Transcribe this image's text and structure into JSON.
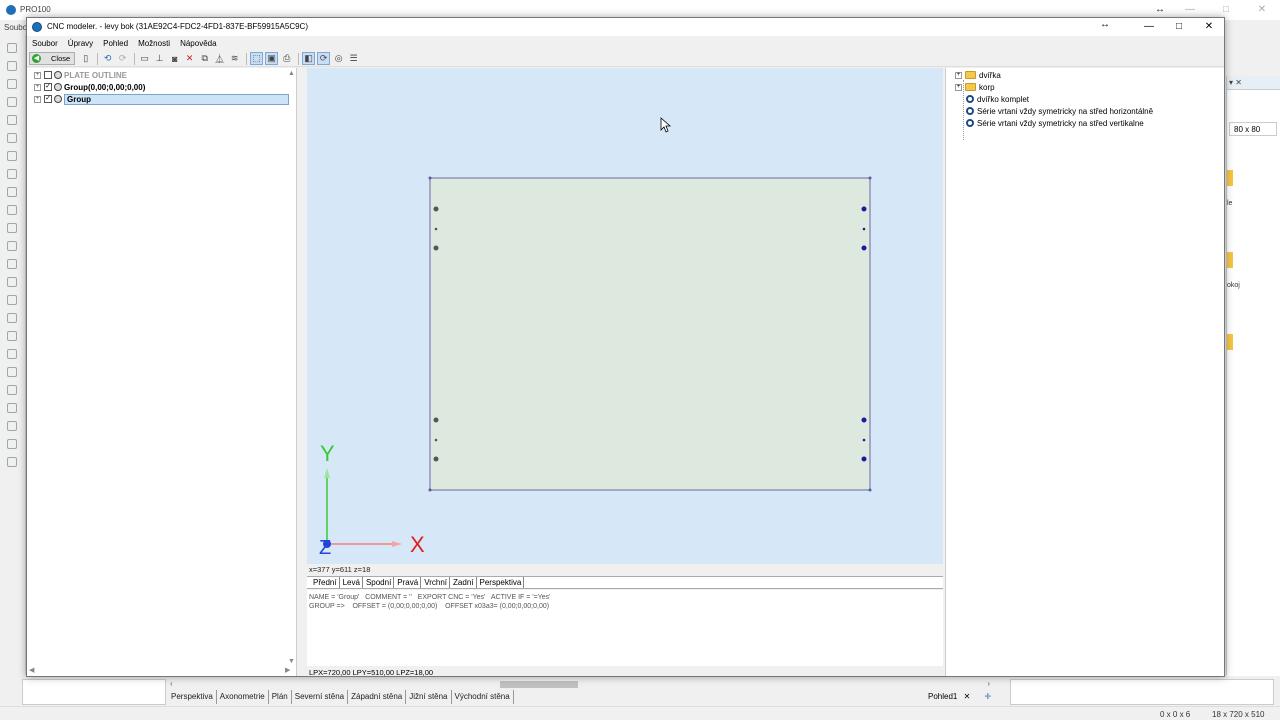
{
  "background_app": {
    "title": "PRO100",
    "menu_label": "Soubo",
    "bottom_tabs": [
      "Perspektiva",
      "Axonometrie",
      "Plán",
      "Severní stěna",
      "Západní stěna",
      "Jižní stěna",
      "Východní stěna"
    ],
    "view_name": "Pohled1",
    "zoom_value": "80 x 80",
    "side_text_1": "le",
    "side_text_2": "okoj",
    "status_left": "0 x 0 x 6",
    "status_right": "18 x 720 x 510"
  },
  "window": {
    "title": "CNC modeler. - levy bok (31AE92C4-FDC2-4FD1-837E-BF59915A5C9C)",
    "menu": [
      "Soubor",
      "Úpravy",
      "Pohled",
      "Možnosti",
      "Nápověda"
    ],
    "close_label": "Close",
    "min_glyph": "—",
    "max_glyph": "□",
    "close_glyph": "✕"
  },
  "tree": {
    "items": [
      {
        "label": "PLATE OUTLINE",
        "checked": false,
        "muted": true
      },
      {
        "label": "Group(0,00;0,00;0,00)",
        "checked": true,
        "muted": false
      },
      {
        "label": "Group",
        "checked": true,
        "muted": false,
        "selected": true
      }
    ]
  },
  "canvas": {
    "axis_x": "X",
    "axis_y": "Y",
    "axis_z": "Z",
    "background_color": "#d6e8f7",
    "plate_color": "#dde8df",
    "coord_readout": "x=377 y=611 z=18"
  },
  "view_tabs": [
    "Přední",
    "Levá",
    "Spodní",
    "Pravá",
    "Vrchní",
    "Zadní",
    "Perspektiva"
  ],
  "properties": {
    "line1": "NAME = 'Group'   COMMENT = ''   EXPORT CNC = 'Yes'   ACTIVE IF = '=Yes'",
    "line2": "GROUP =>    OFFSET = (0,00;0,00;0,00)    OFFSET x03a3= (0,00;0,00;0,00)"
  },
  "dims_readout": "LPX=720,00  LPY=510,00  LPZ=18,00",
  "library": {
    "items": [
      {
        "label": "dvířka",
        "kind": "folder",
        "expandable": true
      },
      {
        "label": "korp",
        "kind": "folder",
        "expandable": true
      },
      {
        "label": "dvířko komplet",
        "kind": "gear",
        "expandable": false
      },
      {
        "label": "Série vrtani vždy symetricky na střed horizontálně",
        "kind": "gear",
        "expandable": false
      },
      {
        "label": "Série vrtani vždy symetricky na střed vertikalne",
        "kind": "gear",
        "expandable": false
      }
    ]
  }
}
